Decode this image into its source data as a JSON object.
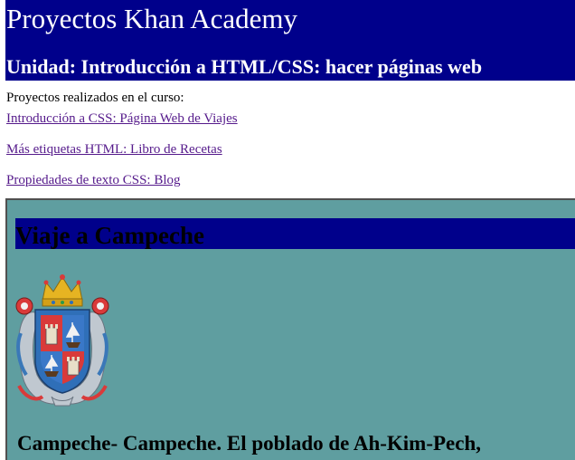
{
  "header": {
    "title": "Proyectos Khan Academy",
    "unit": "Unidad: Introducción a HTML/CSS: hacer páginas web"
  },
  "intro_text": "Proyectos realizados en el curso:",
  "projects": [
    {
      "label": "Introducción a CSS: Página Web de Viajes"
    },
    {
      "label": "Más etiquetas HTML: Libro de Recetas"
    },
    {
      "label": "Propiedades de texto CSS: Blog"
    }
  ],
  "preview": {
    "heading": "Viaje a Campeche",
    "crest_icon": "campeche-coat-of-arms",
    "text": "Campeche- Campeche. El poblado de Ah-Kim-Pech,"
  },
  "colors": {
    "banner": "#00008b",
    "preview_background": "#5f9ea0",
    "link_visited": "#551a8b"
  }
}
